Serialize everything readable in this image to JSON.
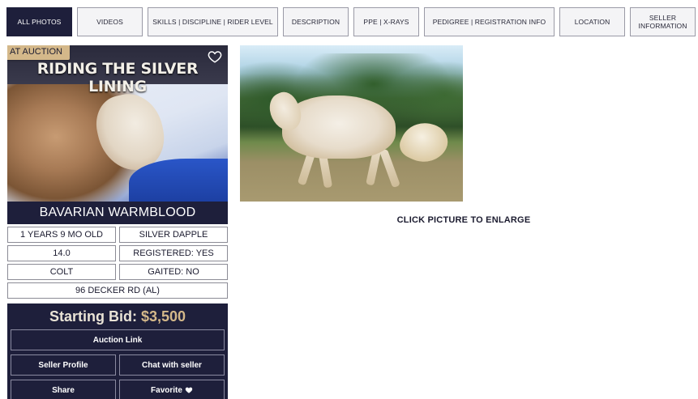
{
  "tabs": [
    {
      "label": "ALL PHOTOS",
      "active": true
    },
    {
      "label": "VIDEOS"
    },
    {
      "label": "SKILLS | DISCIPLINE | RIDER LEVEL"
    },
    {
      "label": "DESCRIPTION"
    },
    {
      "label": "PPE | X-RAYS"
    },
    {
      "label": "PEDIGREE | REGISTRATION INFO"
    },
    {
      "label": "LOCATION"
    },
    {
      "label": "SELLER\nINFORMATION"
    }
  ],
  "card": {
    "badge": "AT AUCTION",
    "photo_title": "RIDING THE SILVER LINING",
    "favorite_icon": "heart-outline-icon",
    "breed": "BAVARIAN WARMBLOOD",
    "specs": {
      "age": "1 YEARS 9 MO OLD",
      "color": "SILVER DAPPLE",
      "height": "14.0",
      "registered": "REGISTERED: YES",
      "sex": "COLT",
      "gaited": "GAITED: NO",
      "location": "96 DECKER RD (AL)"
    }
  },
  "bid": {
    "label": "Starting Bid:",
    "amount": "$3,500",
    "auction_link": "Auction Link",
    "seller_profile": "Seller Profile",
    "chat": "Chat with seller",
    "share": "Share",
    "favorite": "Favorite",
    "favorite_icon": "heart-icon"
  },
  "main": {
    "enlarge_hint": "CLICK PICTURE TO ENLARGE"
  },
  "colors": {
    "navy": "#1e1f3b",
    "gold": "#d4b88a"
  }
}
